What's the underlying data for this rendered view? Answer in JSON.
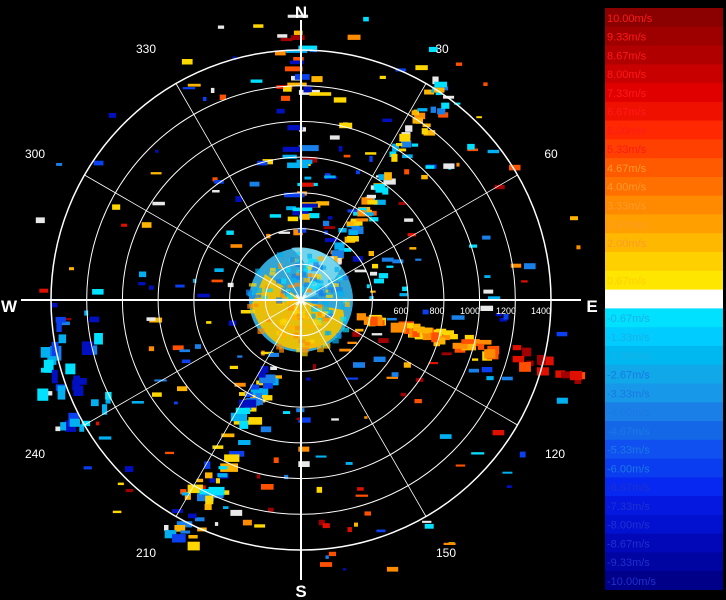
{
  "radar": {
    "compass": {
      "north": "N",
      "south": "S",
      "east": "E",
      "west": "W"
    },
    "bearing_labels": [
      "30",
      "60",
      "120",
      "150",
      "210",
      "240",
      "300",
      "330"
    ],
    "range_labels": [
      "600",
      "800",
      "1000",
      "1200",
      "1400"
    ],
    "range_ring_count": 7
  },
  "legend": {
    "entries": [
      "10.00m/s",
      "9.33m/s",
      "8.67m/s",
      "8.00m/s",
      "7.33m/s",
      "6.67m/s",
      "6.00m/s",
      "5.33m/s",
      "4.67m/s",
      "4.00m/s",
      "3.33m/s",
      "2.67m/s",
      "2.00m/s",
      "1.33m/s",
      "0.67m/s",
      "0.00m/s",
      "-0.67m/s",
      "-1.33m/s",
      "-2.00m/s",
      "-2.67m/s",
      "-3.33m/s",
      "-4.00m/s",
      "-4.67m/s",
      "-5.33m/s",
      "-6.00m/s",
      "-6.67m/s",
      "-7.33m/s",
      "-8.00m/s",
      "-8.67m/s",
      "-9.33m/s",
      "-10.00m/s"
    ],
    "colors": [
      "#8b0000",
      "#9e0000",
      "#b00000",
      "#c80000",
      "#e00000",
      "#f01000",
      "#ff2800",
      "#ff4000",
      "#ff5a00",
      "#ff7000",
      "#ff8a00",
      "#ffa000",
      "#ffb800",
      "#ffd000",
      "#ffe600",
      "#ffffff",
      "#00e0ff",
      "#00ccff",
      "#00b8f0",
      "#10a8e8",
      "#1898e8",
      "#1a80e8",
      "#1468e8",
      "#1050f0",
      "#0a3cf0",
      "#0628f0",
      "#0418e0",
      "#0210d0",
      "#0208b8",
      "#0004a0",
      "#000088"
    ],
    "label_colors": {
      "positive_high": "#ff1a1a",
      "positive_mid": "#ff9a2a",
      "positive_low": "#ffd000",
      "zero": "#ffffff",
      "negative_high": "#1ab0e6",
      "negative_mid": "#1a78e6",
      "negative_low": "#2030d0"
    }
  },
  "echo_colors": {
    "warm": [
      "#ffd700",
      "#ffb400",
      "#ff8c00",
      "#ff5000",
      "#e01000",
      "#a00000"
    ],
    "cool": [
      "#00e0ff",
      "#00b0f0",
      "#1880e8",
      "#0a40f0",
      "#0010c0"
    ],
    "white": "#e8e8e8"
  }
}
